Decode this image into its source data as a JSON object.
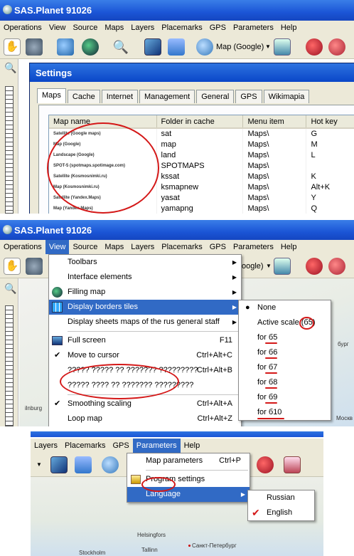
{
  "app_title": "SAS.Planet 91026",
  "menu_items": [
    "Operations",
    "View",
    "Source",
    "Maps",
    "Layers",
    "Placemarks",
    "GPS",
    "Parameters",
    "Help"
  ],
  "menu_items_right": [
    "Layers",
    "Placemarks",
    "GPS",
    "Parameters",
    "Help"
  ],
  "map_dropdown_label": "Map (Google)",
  "map_dropdown_partial": "oogle)",
  "settings": {
    "title": "Settings",
    "tabs": [
      "Maps",
      "Cache",
      "Internet",
      "Management",
      "General",
      "GPS",
      "Wikimapia"
    ],
    "columns": [
      "Map name",
      "Folder in cache",
      "Menu item",
      "Hot key"
    ],
    "rows": [
      {
        "name": "Satellite (Google maps)",
        "folder": "sat",
        "menu": "Maps\\",
        "key": "G"
      },
      {
        "name": "Map (Google)",
        "folder": "map",
        "menu": "Maps\\",
        "key": "M"
      },
      {
        "name": "Landscape (Google)",
        "folder": "land",
        "menu": "Maps\\",
        "key": "L"
      },
      {
        "name": "SPOT-5 (spotmaps.spotimage.com)",
        "folder": "SPOTMAPS",
        "menu": "Maps\\",
        "key": ""
      },
      {
        "name": "Satellite (Kosmosnimki.ru)",
        "folder": "kssat",
        "menu": "Maps\\",
        "key": "K"
      },
      {
        "name": "Map (Kosmosnimki.ru)",
        "folder": "ksmapnew",
        "menu": "Maps\\",
        "key": "Alt+K"
      },
      {
        "name": "Satellite (Yandex.Maps)",
        "folder": "yasat",
        "menu": "Maps\\",
        "key": "Y"
      },
      {
        "name": "Map (Yandex.Maps)",
        "folder": "yamapng",
        "menu": "Maps\\",
        "key": "Q"
      }
    ]
  },
  "view_menu": [
    {
      "label": "Toolbars",
      "shortcut": "",
      "submenu": true,
      "check": false,
      "icon": ""
    },
    {
      "label": "Interface elements",
      "shortcut": "",
      "submenu": true,
      "check": false,
      "icon": ""
    },
    {
      "label": "Filling map",
      "shortcut": "",
      "submenu": true,
      "check": false,
      "icon": "globe-icon"
    },
    {
      "label": "Display borders tiles",
      "shortcut": "",
      "submenu": true,
      "check": false,
      "icon": "grid-icon",
      "highlight": true
    },
    {
      "label": "Display sheets maps of the rus general staff",
      "shortcut": "",
      "submenu": true,
      "check": false,
      "icon": ""
    },
    {
      "label": "Full screen",
      "shortcut": "F11",
      "submenu": false,
      "check": false,
      "icon": "fullscreen-icon"
    },
    {
      "label": "Move to cursor",
      "shortcut": "Ctrl+Alt+C",
      "submenu": false,
      "check": true,
      "icon": ""
    },
    {
      "label": "????? ????? ?? ??????? ?????????",
      "shortcut": "Ctrl+Alt+B",
      "submenu": false,
      "check": false,
      "icon": ""
    },
    {
      "label": "????? ???? ?? ??????? ?????????",
      "shortcut": "",
      "submenu": false,
      "check": false,
      "icon": ""
    },
    {
      "label": "Smoothing scaling",
      "shortcut": "Ctrl+Alt+A",
      "submenu": false,
      "check": true,
      "icon": ""
    },
    {
      "label": "Loop map",
      "shortcut": "Ctrl+Alt+Z",
      "submenu": false,
      "check": false,
      "icon": ""
    }
  ],
  "borders_submenu": [
    "None",
    "Active scale (б5)",
    "for б5",
    "for б6",
    "for б7",
    "for б8",
    "for б9",
    "for б10"
  ],
  "parameters_menu": {
    "items": [
      {
        "label": "Map parameters",
        "shortcut": "Ctrl+P"
      },
      {
        "label": "Program settings",
        "shortcut": ""
      },
      {
        "label": "Language",
        "shortcut": ""
      }
    ],
    "language_submenu": [
      "Russian",
      "English"
    ]
  },
  "map_labels": {
    "city_1": "Helsingfors",
    "city_2": "Tallinn",
    "city_3": "Санкт-Петербург",
    "city_4": "Stockholm",
    "city_5": "Москв",
    "city_6": "ilnburg",
    "city_7": "бург"
  },
  "colors": {
    "accent": "#316ac5",
    "title_bar": "#1b55d6",
    "annotation": "#d41818"
  }
}
